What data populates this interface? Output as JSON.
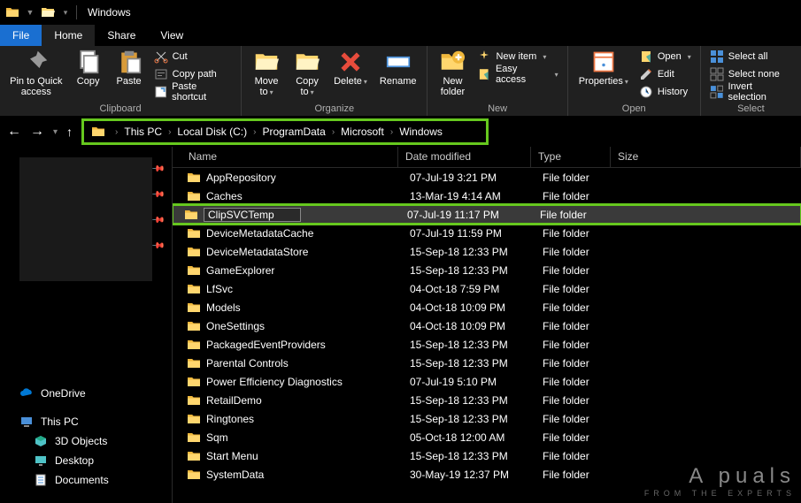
{
  "window_title": "Windows",
  "tabs": {
    "file": "File",
    "home": "Home",
    "share": "Share",
    "view": "View"
  },
  "ribbon": {
    "pin": "Pin to Quick\naccess",
    "copy": "Copy",
    "paste": "Paste",
    "cut": "Cut",
    "copypath": "Copy path",
    "pasteshortcut": "Paste shortcut",
    "clipboard_group": "Clipboard",
    "moveto": "Move\nto",
    "copyto": "Copy\nto",
    "delete": "Delete",
    "rename": "Rename",
    "organize_group": "Organize",
    "newfolder": "New\nfolder",
    "newitem": "New item",
    "easyaccess": "Easy access",
    "new_group": "New",
    "properties": "Properties",
    "open": "Open",
    "edit": "Edit",
    "history": "History",
    "open_group": "Open",
    "selectall": "Select all",
    "selectnone": "Select none",
    "invert": "Invert selection",
    "select_group": "Select"
  },
  "breadcrumb": [
    "This PC",
    "Local Disk (C:)",
    "ProgramData",
    "Microsoft",
    "Windows"
  ],
  "columns": {
    "name": "Name",
    "date": "Date modified",
    "type": "Type",
    "size": "Size"
  },
  "files": [
    {
      "name": "AppRepository",
      "date": "07-Jul-19 3:21 PM",
      "type": "File folder"
    },
    {
      "name": "Caches",
      "date": "13-Mar-19 4:14 AM",
      "type": "File folder"
    },
    {
      "name": "ClipSVCTemp",
      "date": "07-Jul-19 11:17 PM",
      "type": "File folder",
      "highlight": true
    },
    {
      "name": "DeviceMetadataCache",
      "date": "07-Jul-19 11:59 PM",
      "type": "File folder"
    },
    {
      "name": "DeviceMetadataStore",
      "date": "15-Sep-18 12:33 PM",
      "type": "File folder"
    },
    {
      "name": "GameExplorer",
      "date": "15-Sep-18 12:33 PM",
      "type": "File folder"
    },
    {
      "name": "LfSvc",
      "date": "04-Oct-18 7:59 PM",
      "type": "File folder"
    },
    {
      "name": "Models",
      "date": "04-Oct-18 10:09 PM",
      "type": "File folder"
    },
    {
      "name": "OneSettings",
      "date": "04-Oct-18 10:09 PM",
      "type": "File folder"
    },
    {
      "name": "PackagedEventProviders",
      "date": "15-Sep-18 12:33 PM",
      "type": "File folder"
    },
    {
      "name": "Parental Controls",
      "date": "15-Sep-18 12:33 PM",
      "type": "File folder"
    },
    {
      "name": "Power Efficiency Diagnostics",
      "date": "07-Jul-19 5:10 PM",
      "type": "File folder"
    },
    {
      "name": "RetailDemo",
      "date": "15-Sep-18 12:33 PM",
      "type": "File folder"
    },
    {
      "name": "Ringtones",
      "date": "15-Sep-18 12:33 PM",
      "type": "File folder"
    },
    {
      "name": "Sqm",
      "date": "05-Oct-18 12:00 AM",
      "type": "File folder"
    },
    {
      "name": "Start Menu",
      "date": "15-Sep-18 12:33 PM",
      "type": "File folder"
    },
    {
      "name": "SystemData",
      "date": "30-May-19 12:37 PM",
      "type": "File folder"
    }
  ],
  "sidebar": {
    "onedrive": "OneDrive",
    "thispc": "This PC",
    "objects3d": "3D Objects",
    "desktop": "Desktop",
    "documents": "Documents"
  },
  "watermark": {
    "line1": "A  puals",
    "line2": "FROM THE EXPERTS"
  }
}
